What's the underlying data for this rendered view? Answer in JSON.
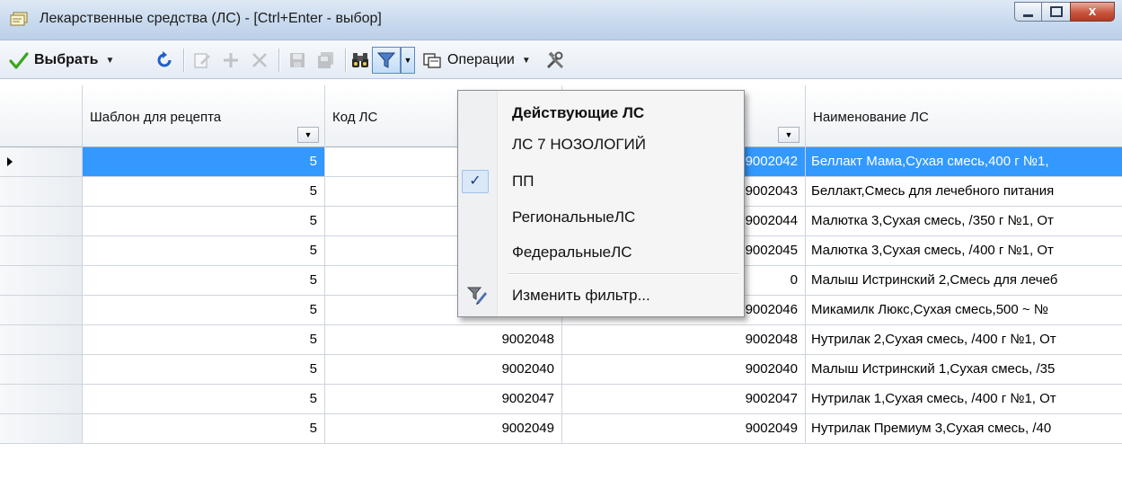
{
  "window": {
    "title": "Лекарственные средства (ЛС) - [Ctrl+Enter - выбор]",
    "close_glyph": "x"
  },
  "toolbar": {
    "select_label": "Выбрать",
    "operations_label": "Операции"
  },
  "grid": {
    "columns": [
      {
        "label": "Шаблон для рецепта"
      },
      {
        "label": "Код ЛС"
      },
      {
        "label": ""
      },
      {
        "label": "Наименование ЛС"
      }
    ],
    "rows": [
      {
        "template": "5",
        "code": "",
        "code2": "9002042",
        "name": "Беллакт Мама,Сухая смесь,400 г №1, "
      },
      {
        "template": "5",
        "code": "",
        "code2": "9002043",
        "name": "Беллакт,Смесь для лечебного питания"
      },
      {
        "template": "5",
        "code": "",
        "code2": "9002044",
        "name": "Малютка 3,Сухая смесь, /350 г №1, От"
      },
      {
        "template": "5",
        "code": "",
        "code2": "9002045",
        "name": "Малютка 3,Сухая смесь, /400 г №1, От"
      },
      {
        "template": "5",
        "code": "",
        "code2": "0",
        "name": "Малыш Истринский 2,Смесь для лечеб"
      },
      {
        "template": "5",
        "code": "9002046",
        "code2": "9002046",
        "name": "Микамилк Люкс,Сухая смесь,500 ~ №"
      },
      {
        "template": "5",
        "code": "9002048",
        "code2": "9002048",
        "name": "Нутрилак 2,Сухая смесь, /400 г №1, От"
      },
      {
        "template": "5",
        "code": "9002040",
        "code2": "9002040",
        "name": "Малыш Истринский 1,Сухая смесь, /35"
      },
      {
        "template": "5",
        "code": "9002047",
        "code2": "9002047",
        "name": "Нутрилак 1,Сухая смесь, /400 г №1, От"
      },
      {
        "template": "5",
        "code": "9002049",
        "code2": "9002049",
        "name": "Нутрилак Премиум 3,Сухая смесь, /40"
      }
    ],
    "selected_row": 0
  },
  "filter_menu": {
    "items": [
      {
        "label": "Действующие ЛС",
        "bold": true,
        "checked": false
      },
      {
        "label": "ЛС 7 НОЗОЛОГИЙ",
        "bold": false,
        "checked": false
      },
      {
        "label": "ПП",
        "bold": false,
        "checked": true
      },
      {
        "label": "РегиональныеЛС",
        "bold": false,
        "checked": false
      },
      {
        "label": "ФедеральныеЛС",
        "bold": false,
        "checked": false
      }
    ],
    "edit_filter_label": "Изменить фильтр...",
    "check_glyph": "✓"
  },
  "colors": {
    "selection": "#3399ff",
    "title_gradient": "#c9daee",
    "close_button": "#c8553f"
  }
}
